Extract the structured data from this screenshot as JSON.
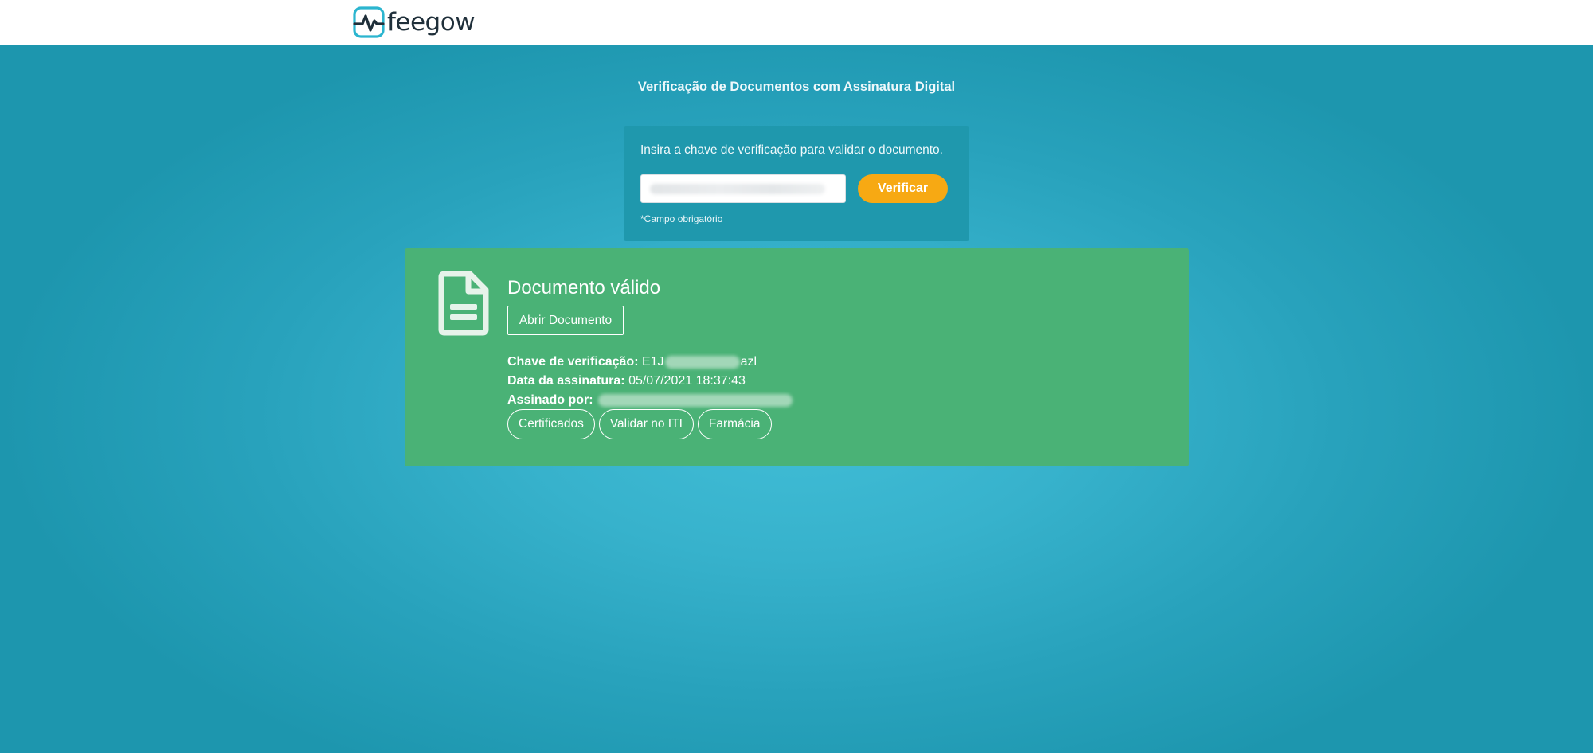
{
  "header": {
    "logo_text": "feegow",
    "logo_icon": "heartbeat-monitor-icon",
    "brand_color": "#2bb5cf"
  },
  "page": {
    "title": "Verificação de Documentos com Assinatura Digital"
  },
  "verify_form": {
    "prompt": "Insira a chave de verificação para validar o documento.",
    "input_value": "",
    "input_value_redacted": true,
    "button_label": "Verificar",
    "required_note": "*Campo obrigatório"
  },
  "result": {
    "status_title": "Documento válido",
    "status_icon": "document-icon",
    "open_button_label": "Abrir Documento",
    "key_label": "Chave de verificação:",
    "key_prefix": "E1J",
    "key_suffix": "azl",
    "date_label": "Data da assinatura:",
    "date_value": "05/07/2021 18:37:43",
    "signer_label": "Assinado por:",
    "actions": [
      {
        "label": "Certificados"
      },
      {
        "label": "Validar no ITI"
      },
      {
        "label": "Farmácia"
      }
    ]
  },
  "colors": {
    "background": "#2ba8c2",
    "form_box": "#1f98ad",
    "verify_button": "#f7a913",
    "valid_panel": "#4ab276"
  }
}
